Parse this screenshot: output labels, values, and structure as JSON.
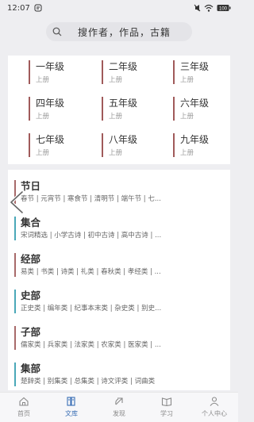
{
  "status_bar": {
    "time": "12:07",
    "battery": "100"
  },
  "search": {
    "placeholder": "搜作者，作品，古籍"
  },
  "grades": [
    {
      "title": "一年级",
      "sub": "上册"
    },
    {
      "title": "二年级",
      "sub": "上册"
    },
    {
      "title": "三年级",
      "sub": "上册"
    },
    {
      "title": "四年级",
      "sub": "上册"
    },
    {
      "title": "五年级",
      "sub": "上册"
    },
    {
      "title": "六年级",
      "sub": "上册"
    },
    {
      "title": "七年级",
      "sub": "上册"
    },
    {
      "title": "八年级",
      "sub": "上册"
    },
    {
      "title": "九年级",
      "sub": "上册"
    }
  ],
  "categories": [
    {
      "name": "节日",
      "items": "春节 | 元宵节 | 寒食节 | 清明节 | 端午节 | 七...",
      "color": "#a86a6a"
    },
    {
      "name": "集合",
      "items": "宋词精选 | 小学古诗 | 初中古诗 | 高中古诗 | ...",
      "color": "#4aa8b8"
    },
    {
      "name": "经部",
      "items": "易类 | 书类 | 诗类 | 礼类 | 春秋类 | 孝经类 | ...",
      "color": "#a86a6a"
    },
    {
      "name": "史部",
      "items": "正史类 | 编年类 | 纪事本末类 | 杂史类 | 别史...",
      "color": "#4aa8b8"
    },
    {
      "name": "子部",
      "items": "儒家类 | 兵家类 | 法家类 | 农家类 | 医家类 | ...",
      "color": "#a86a6a"
    },
    {
      "name": "集部",
      "items": "楚辞类 | 别集类 | 总集类 | 诗文评类 | 词曲类",
      "color": "#4aa8b8"
    }
  ],
  "tabs": [
    {
      "label": "首页",
      "icon": "home-icon"
    },
    {
      "label": "文库",
      "icon": "library-icon"
    },
    {
      "label": "发现",
      "icon": "discover-icon"
    },
    {
      "label": "学习",
      "icon": "book-icon"
    },
    {
      "label": "个人中心",
      "icon": "person-icon"
    }
  ],
  "colors": {
    "accent": "#3a6fb5",
    "grade_bar": "#a05a5a"
  }
}
